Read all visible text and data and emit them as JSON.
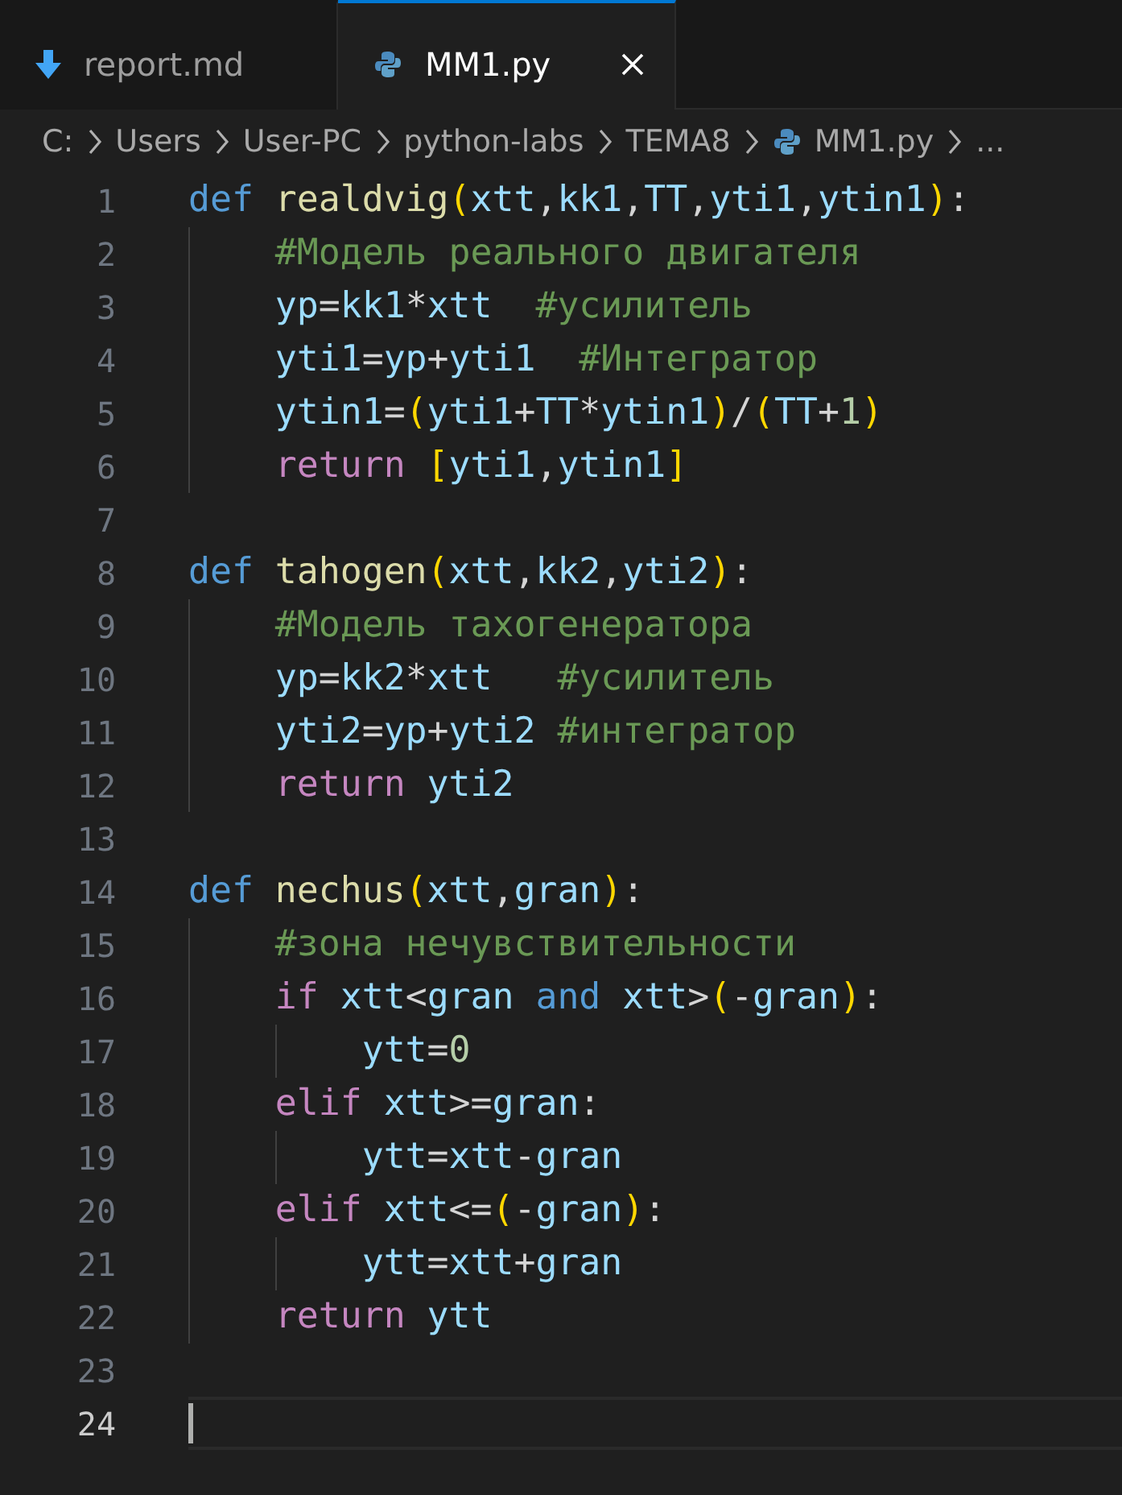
{
  "tabs": [
    {
      "label": "report.md",
      "kind": "markdown",
      "selected": false
    },
    {
      "label": "MM1.py",
      "kind": "python",
      "selected": true
    }
  ],
  "breadcrumbs": [
    {
      "label": "C:",
      "kind": "folder"
    },
    {
      "label": "Users",
      "kind": "folder"
    },
    {
      "label": "User-PC",
      "kind": "folder"
    },
    {
      "label": "python-labs",
      "kind": "folder"
    },
    {
      "label": "TEMA8",
      "kind": "folder"
    },
    {
      "label": "MM1.py",
      "kind": "python"
    },
    {
      "label": "...",
      "kind": "more"
    }
  ],
  "lines": [
    {
      "number": "1",
      "current": false,
      "tokens": [
        {
          "kind": "kw",
          "text": "def "
        },
        {
          "kind": "fn",
          "text": "realdvig"
        },
        {
          "kind": "br",
          "text": "("
        },
        {
          "kind": "var",
          "text": "xtt"
        },
        {
          "kind": "op",
          "text": ","
        },
        {
          "kind": "var",
          "text": "kk1"
        },
        {
          "kind": "op",
          "text": ","
        },
        {
          "kind": "var",
          "text": "TT"
        },
        {
          "kind": "op",
          "text": ","
        },
        {
          "kind": "var",
          "text": "yti1"
        },
        {
          "kind": "op",
          "text": ","
        },
        {
          "kind": "var",
          "text": "ytin1"
        },
        {
          "kind": "br",
          "text": ")"
        },
        {
          "kind": "op",
          "text": ":"
        }
      ]
    },
    {
      "number": "2",
      "current": false,
      "tokens": [
        {
          "kind": "cmt",
          "text": "    #Модель реального двигателя"
        }
      ]
    },
    {
      "number": "3",
      "current": false,
      "tokens": [
        {
          "kind": "var",
          "text": "    yp"
        },
        {
          "kind": "op",
          "text": "="
        },
        {
          "kind": "var",
          "text": "kk1"
        },
        {
          "kind": "op",
          "text": "*"
        },
        {
          "kind": "var",
          "text": "xtt  "
        },
        {
          "kind": "cmt",
          "text": "#усилитель"
        }
      ]
    },
    {
      "number": "4",
      "current": false,
      "tokens": [
        {
          "kind": "var",
          "text": "    yti1"
        },
        {
          "kind": "op",
          "text": "="
        },
        {
          "kind": "var",
          "text": "yp"
        },
        {
          "kind": "op",
          "text": "+"
        },
        {
          "kind": "var",
          "text": "yti1  "
        },
        {
          "kind": "cmt",
          "text": "#Интегратор"
        }
      ]
    },
    {
      "number": "5",
      "current": false,
      "tokens": [
        {
          "kind": "var",
          "text": "    ytin1"
        },
        {
          "kind": "op",
          "text": "="
        },
        {
          "kind": "br",
          "text": "("
        },
        {
          "kind": "var",
          "text": "yti1"
        },
        {
          "kind": "op",
          "text": "+"
        },
        {
          "kind": "var",
          "text": "TT"
        },
        {
          "kind": "op",
          "text": "*"
        },
        {
          "kind": "var",
          "text": "ytin1"
        },
        {
          "kind": "br",
          "text": ")"
        },
        {
          "kind": "op",
          "text": "/"
        },
        {
          "kind": "br",
          "text": "("
        },
        {
          "kind": "var",
          "text": "TT"
        },
        {
          "kind": "op",
          "text": "+"
        },
        {
          "kind": "num",
          "text": "1"
        },
        {
          "kind": "br",
          "text": ")"
        }
      ]
    },
    {
      "number": "6",
      "current": false,
      "tokens": [
        {
          "kind": "ctl",
          "text": "    return "
        },
        {
          "kind": "br",
          "text": "["
        },
        {
          "kind": "var",
          "text": "yti1"
        },
        {
          "kind": "op",
          "text": ","
        },
        {
          "kind": "var",
          "text": "ytin1"
        },
        {
          "kind": "br",
          "text": "]"
        }
      ]
    },
    {
      "number": "7",
      "current": false
    },
    {
      "number": "8",
      "current": false,
      "tokens": [
        {
          "kind": "kw",
          "text": "def "
        },
        {
          "kind": "fn",
          "text": "tahogen"
        },
        {
          "kind": "br",
          "text": "("
        },
        {
          "kind": "var",
          "text": "xtt"
        },
        {
          "kind": "op",
          "text": ","
        },
        {
          "kind": "var",
          "text": "kk2"
        },
        {
          "kind": "op",
          "text": ","
        },
        {
          "kind": "var",
          "text": "yti2"
        },
        {
          "kind": "br",
          "text": ")"
        },
        {
          "kind": "op",
          "text": ":"
        }
      ]
    },
    {
      "number": "9",
      "current": false,
      "tokens": [
        {
          "kind": "cmt",
          "text": "    #Модель тахогенератора"
        }
      ]
    },
    {
      "number": "10",
      "current": false,
      "tokens": [
        {
          "kind": "var",
          "text": "    yp"
        },
        {
          "kind": "op",
          "text": "="
        },
        {
          "kind": "var",
          "text": "kk2"
        },
        {
          "kind": "op",
          "text": "*"
        },
        {
          "kind": "var",
          "text": "xtt   "
        },
        {
          "kind": "cmt",
          "text": "#усилитель"
        }
      ]
    },
    {
      "number": "11",
      "current": false,
      "tokens": [
        {
          "kind": "var",
          "text": "    yti2"
        },
        {
          "kind": "op",
          "text": "="
        },
        {
          "kind": "var",
          "text": "yp"
        },
        {
          "kind": "op",
          "text": "+"
        },
        {
          "kind": "var",
          "text": "yti2 "
        },
        {
          "kind": "cmt",
          "text": "#интегратор"
        }
      ]
    },
    {
      "number": "12",
      "current": false,
      "tokens": [
        {
          "kind": "ctl",
          "text": "    return "
        },
        {
          "kind": "var",
          "text": "yti2"
        }
      ]
    },
    {
      "number": "13",
      "current": false
    },
    {
      "number": "14",
      "current": false,
      "tokens": [
        {
          "kind": "kw",
          "text": "def "
        },
        {
          "kind": "fn",
          "text": "nechus"
        },
        {
          "kind": "br",
          "text": "("
        },
        {
          "kind": "var",
          "text": "xtt"
        },
        {
          "kind": "op",
          "text": ","
        },
        {
          "kind": "var",
          "text": "gran"
        },
        {
          "kind": "br",
          "text": ")"
        },
        {
          "kind": "op",
          "text": ":"
        }
      ]
    },
    {
      "number": "15",
      "current": false,
      "tokens": [
        {
          "kind": "cmt",
          "text": "    #зона нечувствительности"
        }
      ]
    },
    {
      "number": "16",
      "current": false,
      "tokens": [
        {
          "kind": "ctl",
          "text": "    if "
        },
        {
          "kind": "var",
          "text": "xtt"
        },
        {
          "kind": "op",
          "text": "<"
        },
        {
          "kind": "var",
          "text": "gran "
        },
        {
          "kind": "kw",
          "text": "and "
        },
        {
          "kind": "var",
          "text": "xtt"
        },
        {
          "kind": "op",
          "text": ">"
        },
        {
          "kind": "br",
          "text": "("
        },
        {
          "kind": "op",
          "text": "-"
        },
        {
          "kind": "var",
          "text": "gran"
        },
        {
          "kind": "br",
          "text": ")"
        },
        {
          "kind": "op",
          "text": ":"
        }
      ]
    },
    {
      "number": "17",
      "current": false,
      "tokens": [
        {
          "kind": "var",
          "text": "        ytt"
        },
        {
          "kind": "op",
          "text": "="
        },
        {
          "kind": "num",
          "text": "0"
        }
      ]
    },
    {
      "number": "18",
      "current": false,
      "tokens": [
        {
          "kind": "ctl",
          "text": "    elif "
        },
        {
          "kind": "var",
          "text": "xtt"
        },
        {
          "kind": "op",
          "text": ">="
        },
        {
          "kind": "var",
          "text": "gran"
        },
        {
          "kind": "op",
          "text": ":"
        }
      ]
    },
    {
      "number": "19",
      "current": false,
      "tokens": [
        {
          "kind": "var",
          "text": "        ytt"
        },
        {
          "kind": "op",
          "text": "="
        },
        {
          "kind": "var",
          "text": "xtt"
        },
        {
          "kind": "op",
          "text": "-"
        },
        {
          "kind": "var",
          "text": "gran"
        }
      ]
    },
    {
      "number": "20",
      "current": false,
      "tokens": [
        {
          "kind": "ctl",
          "text": "    elif "
        },
        {
          "kind": "var",
          "text": "xtt"
        },
        {
          "kind": "op",
          "text": "<="
        },
        {
          "kind": "br",
          "text": "("
        },
        {
          "kind": "op",
          "text": "-"
        },
        {
          "kind": "var",
          "text": "gran"
        },
        {
          "kind": "br",
          "text": ")"
        },
        {
          "kind": "op",
          "text": ":"
        }
      ]
    },
    {
      "number": "21",
      "current": false,
      "tokens": [
        {
          "kind": "var",
          "text": "        ytt"
        },
        {
          "kind": "op",
          "text": "="
        },
        {
          "kind": "var",
          "text": "xtt"
        },
        {
          "kind": "op",
          "text": "+"
        },
        {
          "kind": "var",
          "text": "gran"
        }
      ]
    },
    {
      "number": "22",
      "current": false,
      "tokens": [
        {
          "kind": "ctl",
          "text": "    return "
        },
        {
          "kind": "var",
          "text": "ytt"
        }
      ]
    },
    {
      "number": "23",
      "current": false
    },
    {
      "number": "24",
      "current": true
    }
  ]
}
